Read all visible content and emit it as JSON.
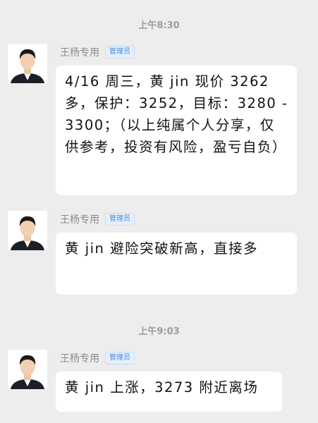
{
  "chat": {
    "timestamps": [
      "上午8:30",
      "上午9:03"
    ],
    "messages": [
      {
        "sender": "王杨专用",
        "role": "管理员",
        "text": "4/16 周三，黄 jin 现价 3262 多，保护：3252，目标：3280 - 3300；（以上纯属个人分享，仅供参考，投资有风险，盈亏自负）"
      },
      {
        "sender": "王杨专用",
        "role": "管理员",
        "text": "黄 jin 避险突破新高，直接多"
      },
      {
        "sender": "王杨专用",
        "role": "管理员",
        "text": "黄 jin 上涨，3273 附近离场"
      }
    ]
  },
  "colors": {
    "background": "#ededed",
    "bubble": "#ffffff",
    "badge_text": "#4a8bd8",
    "badge_bg": "#e6f0fb"
  }
}
